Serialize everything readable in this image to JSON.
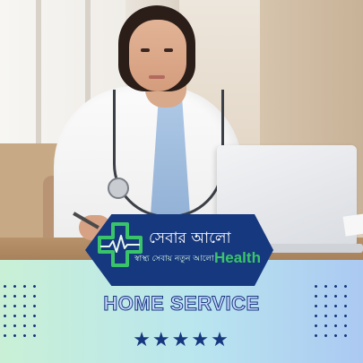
{
  "brand": {
    "title": "সেবার আলো",
    "tagline": "স্বাস্থ্য সেবায় নতুন আলো",
    "suffix": "Health",
    "logo_icon": "medical-cross-heartbeat-icon"
  },
  "service": {
    "label": "HOME SERVICE"
  },
  "rating": {
    "stars_text": "★★★★★",
    "value": 5,
    "max": 5,
    "icon": "star-icon"
  },
  "colors": {
    "navy": "#16387f",
    "green": "#39c46a",
    "panel_start": "#c9f0d6",
    "panel_end": "#abc9f2"
  }
}
